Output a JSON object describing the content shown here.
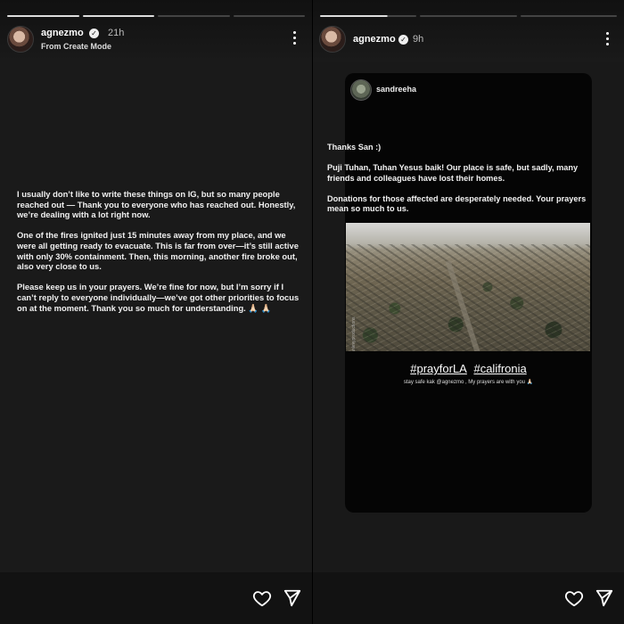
{
  "left": {
    "username": "agnezmo",
    "time": "21h",
    "subtitle": "From Create Mode",
    "paragraphs": [
      "I usually don’t like to write these things on IG, but so many people reached out — Thank you to everyone who has reached out. Honestly, we’re dealing with a lot right now.",
      "One of the fires ignited just 15 minutes away from my place, and we were all getting ready to evacuate. This is far from over—it’s still active with only 30% containment. Then, this morning, another fire broke out, also very close to us.",
      "Please keep us in your prayers. We’re fine for now, but I’m sorry if I can’t reply to everyone individually—we’ve got other priorities to focus on at the moment. Thank you so much for understanding. 🙏🏻 🙏🏻"
    ]
  },
  "right": {
    "username": "agnezmo",
    "time": "9h",
    "card": {
      "username": "sandreeha",
      "paragraphs": [
        "Thanks San :)",
        "Puji Tuhan, Tuhan Yesus baik! Our place is safe, but sadly, many friends and colleagues have lost their homes.",
        "Donations for those affected are desperately needed. Your prayers mean so much to us."
      ],
      "photo_watermark": "ryanlevyproductions",
      "hashtag_1": "#prayforLA",
      "hashtag_2": "#califronia",
      "caption": "stay safe kak @agnezmo , My prayers are with you 🙏🏻"
    }
  },
  "icons": {
    "verified": "verified-badge-icon",
    "more": "more-options-icon",
    "like": "heart-icon",
    "share": "send-icon"
  }
}
